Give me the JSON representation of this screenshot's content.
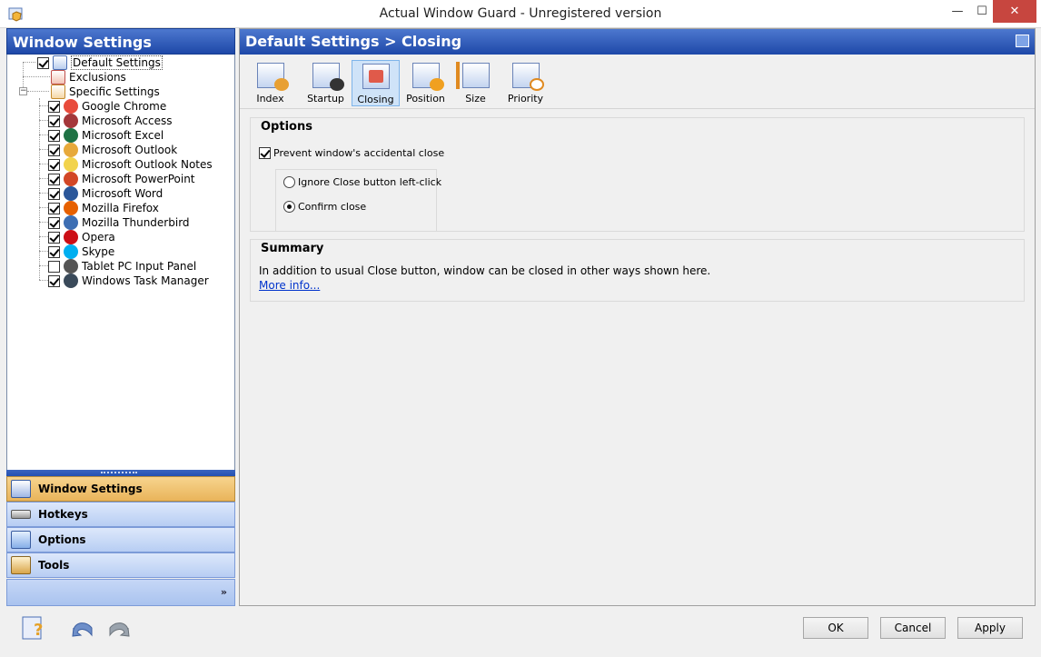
{
  "window": {
    "title": "Actual Window Guard - Unregistered version",
    "minimize_glyph": "—",
    "maximize_glyph": "☐",
    "close_glyph": "✕"
  },
  "left_panel": {
    "title": "Window Settings",
    "tree": {
      "default_settings": "Default Settings",
      "exclusions": "Exclusions",
      "specific_settings": "Specific Settings",
      "expander_glyph": "−",
      "apps": [
        {
          "label": "Google Chrome",
          "checked": true,
          "icon": "chrome-icon",
          "color": "#e84b3c"
        },
        {
          "label": "Microsoft Access",
          "checked": true,
          "icon": "access-icon",
          "color": "#a4373a"
        },
        {
          "label": "Microsoft Excel",
          "checked": true,
          "icon": "excel-icon",
          "color": "#1f7244"
        },
        {
          "label": "Microsoft Outlook",
          "checked": true,
          "icon": "outlook-icon",
          "color": "#e7a93b"
        },
        {
          "label": "Microsoft Outlook Notes",
          "checked": true,
          "icon": "notes-icon",
          "color": "#f2d34c"
        },
        {
          "label": "Microsoft PowerPoint",
          "checked": true,
          "icon": "powerpoint-icon",
          "color": "#d24726"
        },
        {
          "label": "Microsoft Word",
          "checked": true,
          "icon": "word-icon",
          "color": "#2b579a"
        },
        {
          "label": "Mozilla Firefox",
          "checked": true,
          "icon": "firefox-icon",
          "color": "#e66000"
        },
        {
          "label": "Mozilla Thunderbird",
          "checked": true,
          "icon": "thunderbird-icon",
          "color": "#3d6eb3"
        },
        {
          "label": "Opera",
          "checked": true,
          "icon": "opera-icon",
          "color": "#cc0f16"
        },
        {
          "label": "Skype",
          "checked": true,
          "icon": "skype-icon",
          "color": "#00aff0"
        },
        {
          "label": "Tablet PC Input Panel",
          "checked": false,
          "icon": "keyboard-icon",
          "color": "#555555"
        },
        {
          "label": "Windows Task Manager",
          "checked": true,
          "icon": "task-manager-icon",
          "color": "#3a4a5a"
        }
      ]
    },
    "nav": {
      "window_settings": "Window Settings",
      "hotkeys": "Hotkeys",
      "options": "Options",
      "tools": "Tools",
      "more_glyph": "»"
    }
  },
  "right_panel": {
    "title": "Default Settings > Closing",
    "tabs": [
      "Index",
      "Startup",
      "Closing",
      "Position",
      "Size",
      "Priority"
    ],
    "active_tab": "Closing",
    "options": {
      "title": "Options",
      "prevent_close": "Prevent window's accidental close",
      "prevent_checked": true,
      "ignore_close": "Ignore Close button left-click",
      "confirm_close": "Confirm close",
      "selected": "confirm_close"
    },
    "summary": {
      "title": "Summary",
      "text": "In addition to usual Close button, window can be closed in other ways shown here.",
      "link": "More info..."
    }
  },
  "buttons": {
    "ok": "OK",
    "cancel": "Cancel",
    "apply": "Apply"
  },
  "colors": {
    "header_blue": "#1e48a8",
    "active_nav": "#e9b45a",
    "link": "#0033cc"
  }
}
